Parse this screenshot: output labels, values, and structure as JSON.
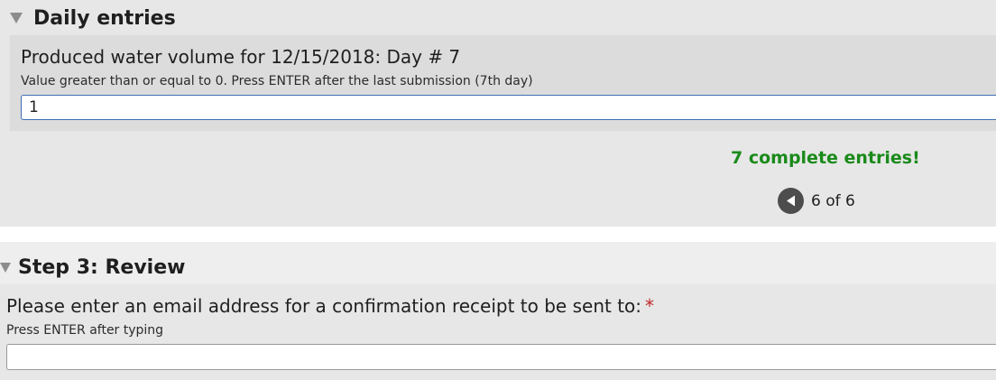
{
  "daily_entries": {
    "title": "Daily entries",
    "question": {
      "label": "Produced water volume for 12/15/2018: Day # 7",
      "hint": "Value greater than or equal to 0. Press ENTER after the last submission (7th day)",
      "value": "1"
    },
    "status": {
      "message": "7 complete entries!",
      "color": "#1a8a1a"
    },
    "pager": {
      "text": "6 of 6",
      "prev_icon": "arrow-left-circle-icon"
    }
  },
  "step3": {
    "title": "Step 3: Review",
    "email": {
      "label": "Please enter an email address for a confirmation receipt to be sent to:",
      "required_marker": "*",
      "hint": "Press ENTER after typing",
      "value": ""
    }
  },
  "colors": {
    "group_background": "#e6e7e6",
    "question_background": "#dcdcdc",
    "input_focus_border": "#3f6fb5",
    "required": "#c0282d"
  }
}
